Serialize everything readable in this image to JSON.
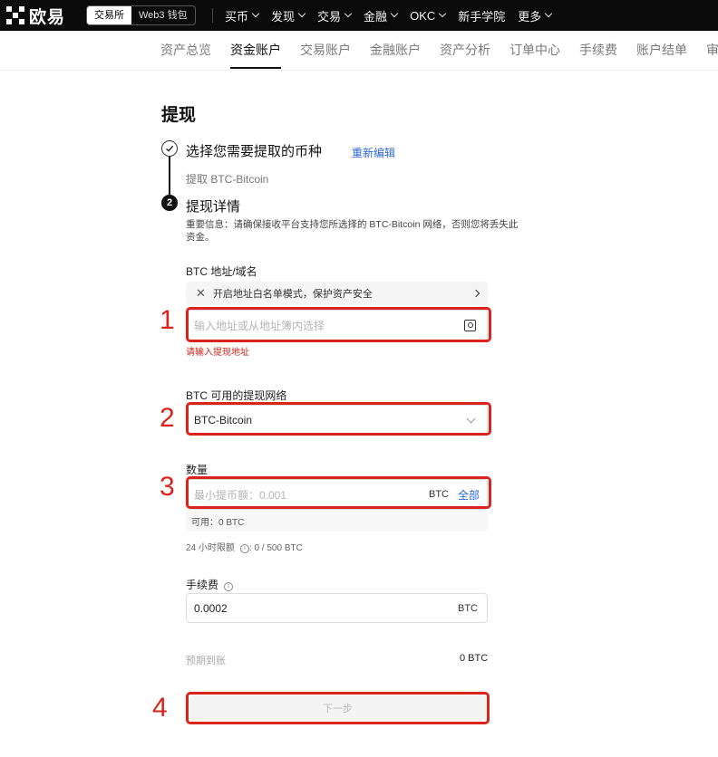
{
  "topnav": {
    "brand": "欧易",
    "mode_exchange": "交易所",
    "mode_wallet": "Web3 钱包",
    "menu": [
      {
        "label": "买币",
        "dropdown": true
      },
      {
        "label": "发现",
        "dropdown": true
      },
      {
        "label": "交易",
        "dropdown": true
      },
      {
        "label": "金融",
        "dropdown": true
      },
      {
        "label": "OKC",
        "dropdown": true
      },
      {
        "label": "新手学院",
        "dropdown": false
      },
      {
        "label": "更多",
        "dropdown": true
      }
    ]
  },
  "subnav": {
    "tabs": [
      "资产总览",
      "资金账户",
      "交易账户",
      "金融账户",
      "资产分析",
      "订单中心",
      "手续费",
      "账户结单",
      "审计"
    ],
    "active": "资金账户"
  },
  "page": {
    "title": "提现",
    "step1": {
      "number": "1",
      "title": "选择您需要提取的币种",
      "edit_label": "重新编辑",
      "subtitle": "提取 BTC-Bitcoin"
    },
    "step2": {
      "number": "2",
      "title": "提现详情",
      "notice": "重要信息：请确保接收平台支持您所选择的 BTC-Bitcoin 网络，否则您将丢失此资金。"
    },
    "address": {
      "label": "BTC 地址/域名",
      "whitelist_text": "开启地址白名单模式，保护资产安全",
      "placeholder": "输入地址或从地址簿内选择",
      "error": "请输入提现地址"
    },
    "network": {
      "label": "BTC 可用的提现网络",
      "value": "BTC-Bitcoin"
    },
    "amount": {
      "label": "数量",
      "placeholder": "最小提币额：0.001",
      "unit": "BTC",
      "all_label": "全部",
      "available": "可用：0 BTC",
      "limit_prefix": "24 小时限额",
      "limit_value": ": 0 / 500 BTC"
    },
    "fee": {
      "label": "手续费",
      "value": "0.0002",
      "unit": "BTC"
    },
    "receive": {
      "label": "预期到账",
      "value": "0 BTC"
    },
    "next_label": "下一步"
  },
  "annotations": [
    "1",
    "2",
    "3",
    "4"
  ],
  "colors": {
    "annotation_red": "#d9231b",
    "link_blue": "#2c68d8",
    "nav_bg": "#0b0b0b"
  }
}
